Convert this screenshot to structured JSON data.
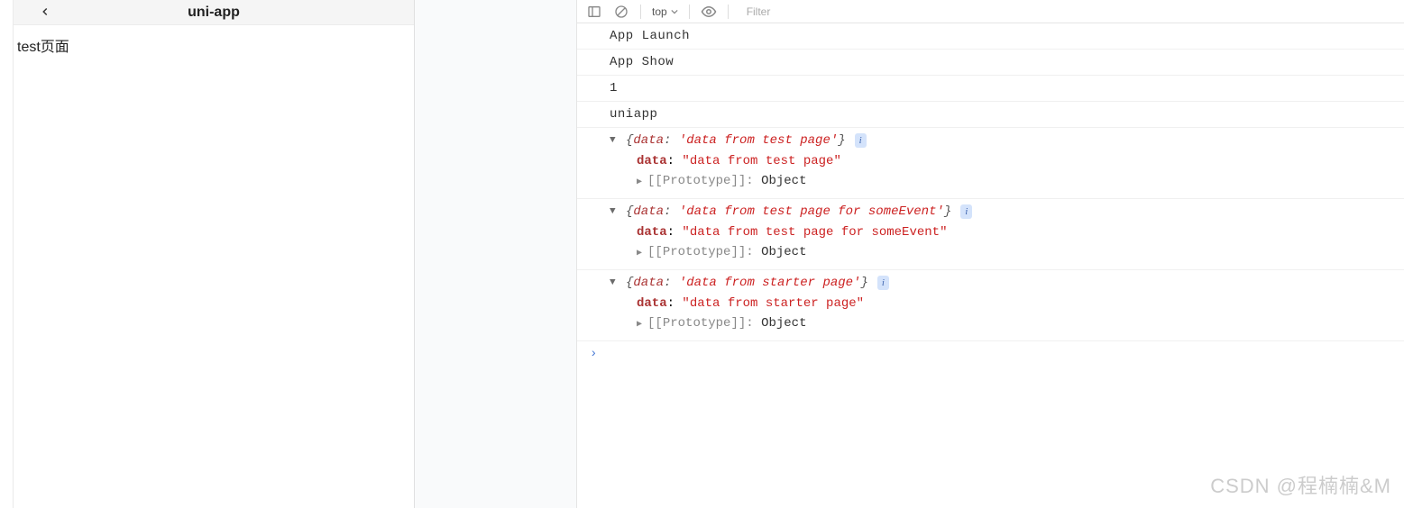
{
  "simulator": {
    "title": "uni-app",
    "page_text": "test页面"
  },
  "toolbar": {
    "context": "top",
    "filter_placeholder": "Filter"
  },
  "console": {
    "logs": [
      "App Launch",
      "App Show",
      "1",
      "uniapp"
    ],
    "objects": [
      {
        "summary_key": "data",
        "summary_val": "'data from test page'",
        "prop_key": "data",
        "prop_val": "\"data from test page\"",
        "proto_label": "[[Prototype]]",
        "proto_val": "Object"
      },
      {
        "summary_key": "data",
        "summary_val": "'data from test page for someEvent'",
        "prop_key": "data",
        "prop_val": "\"data from test page for someEvent\"",
        "proto_label": "[[Prototype]]",
        "proto_val": "Object"
      },
      {
        "summary_key": "data",
        "summary_val": "'data from starter page'",
        "prop_key": "data",
        "prop_val": "\"data from starter page\"",
        "proto_label": "[[Prototype]]",
        "proto_val": "Object"
      }
    ],
    "info_badge": "i",
    "prompt": "›"
  },
  "watermark": "CSDN @程楠楠&M"
}
